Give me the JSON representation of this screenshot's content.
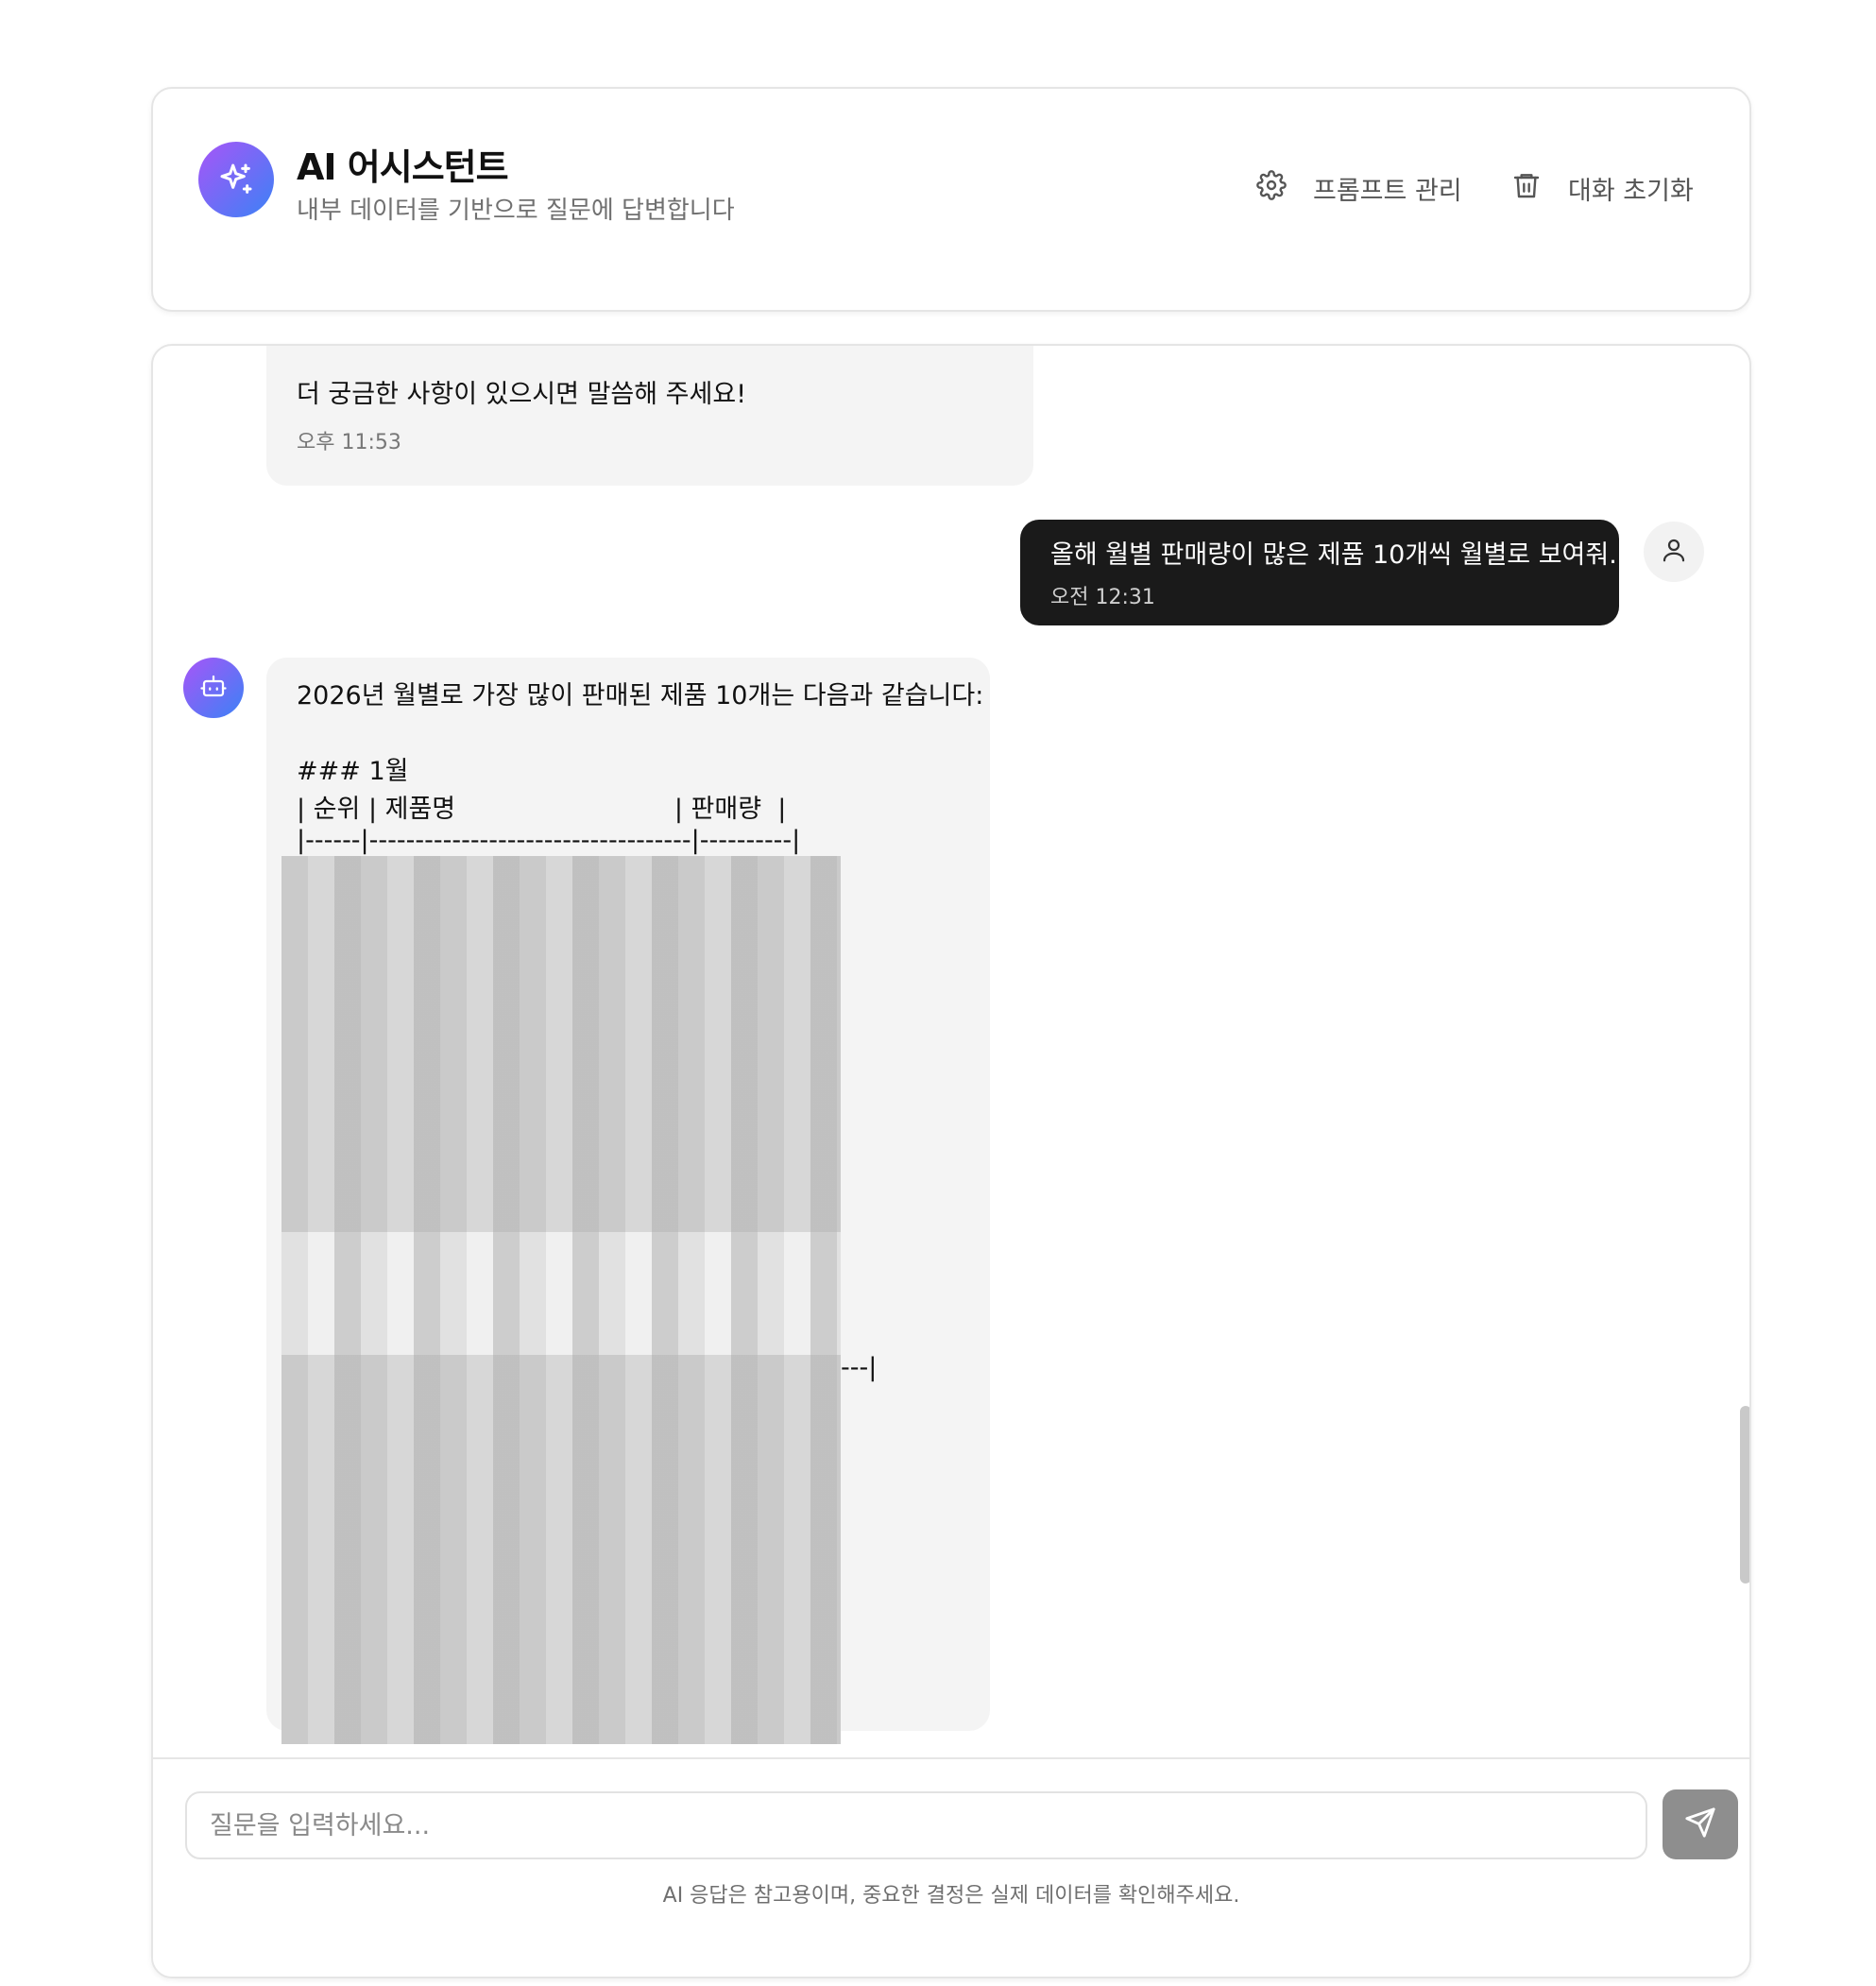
{
  "header": {
    "title": "AI 어시스턴트",
    "subtitle": "내부 데이터를 기반으로 질문에 답변합니다",
    "prompt_button_label": "프롬프트 관리",
    "reset_button_label": "대화 초기화"
  },
  "messages": {
    "previous_ai": {
      "text": "더 궁금한 사항이 있으시면 말씀해 주세요!",
      "time": "오후 11:53"
    },
    "user": {
      "text": "올해 월별 판매량이 많은 제품 10개씩 월별로 보여줘.",
      "time": "오전 12:31"
    },
    "ai_response": {
      "intro": "2026년 월별로 가장 많이 판매된 제품 10개는 다음과 같습니다:",
      "heading": "### 1월",
      "table_header": "| 순위 | 제품명                           | 판매량  |",
      "table_divider": "|------|-----------------------------------|----------|",
      "tail": "---|"
    }
  },
  "input": {
    "placeholder": "질문을 입력하세요...",
    "disclaimer": "AI 응답은 참고용이며, 중요한 결정은 실제 데이터를 확인해주세요."
  },
  "icons": {
    "brand": "sparkles-icon",
    "prompt": "gear-icon",
    "reset": "trash-icon",
    "user": "user-icon",
    "bot": "bot-icon",
    "send": "send-icon"
  },
  "colors": {
    "brand_gradient_start": "#a855f7",
    "brand_gradient_end": "#3b82f6",
    "user_bubble": "#1a1a1a",
    "ai_bubble": "#f4f4f4",
    "send_button": "#8e8e8e"
  }
}
